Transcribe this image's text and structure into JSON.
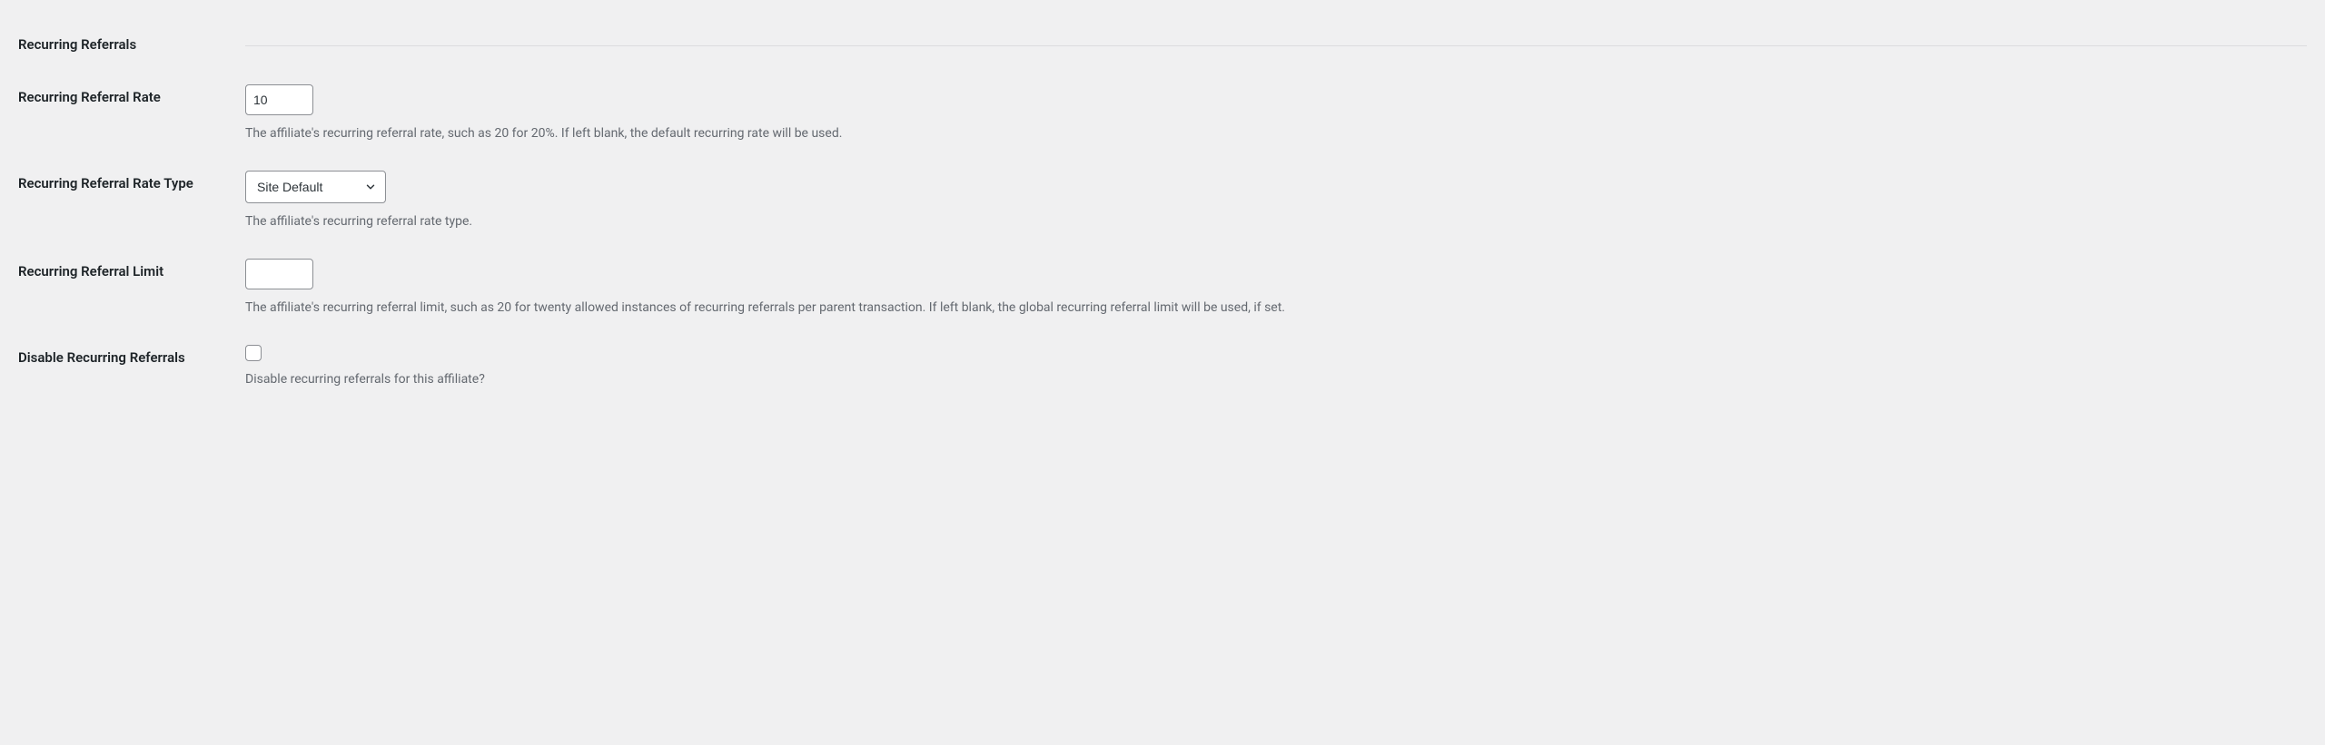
{
  "section": {
    "heading": "Recurring Referrals"
  },
  "fields": {
    "recurring_rate": {
      "label": "Recurring Referral Rate",
      "value": "10",
      "description": "The affiliate's recurring referral rate, such as 20 for 20%. If left blank, the default recurring rate will be used."
    },
    "recurring_rate_type": {
      "label": "Recurring Referral Rate Type",
      "value": "Site Default",
      "description": "The affiliate's recurring referral rate type."
    },
    "recurring_limit": {
      "label": "Recurring Referral Limit",
      "value": "",
      "description": "The affiliate's recurring referral limit, such as 20 for twenty allowed instances of recurring referrals per parent transaction. If left blank, the global recurring referral limit will be used, if set."
    },
    "disable_recurring": {
      "label": "Disable Recurring Referrals",
      "description": "Disable recurring referrals for this affiliate?"
    }
  }
}
